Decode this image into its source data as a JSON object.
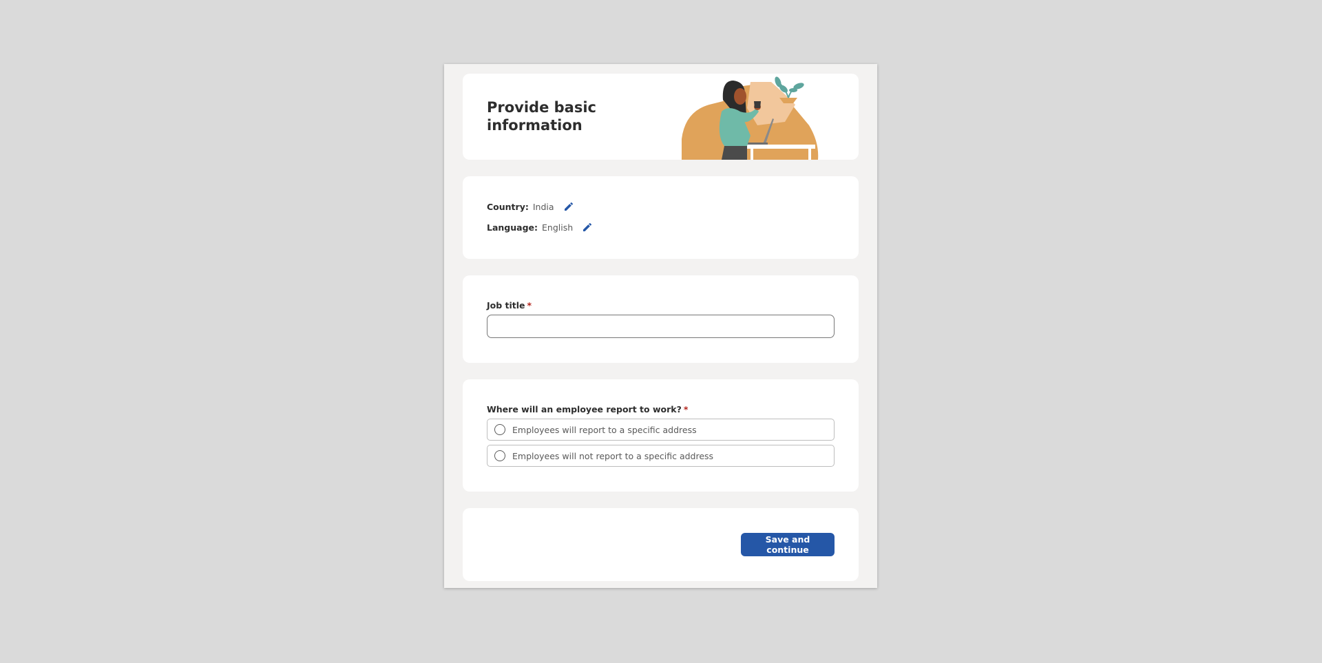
{
  "header": {
    "title": "Provide basic information",
    "illustration_icon": "woman-with-laptop-illustration"
  },
  "locale": {
    "country_label": "Country:",
    "country_value": "India",
    "language_label": "Language:",
    "language_value": "English",
    "edit_icon": "pencil-icon"
  },
  "job_title": {
    "label": "Job title",
    "required_marker": "*",
    "value": "",
    "placeholder": ""
  },
  "report_location": {
    "question": "Where will an employee report to work?",
    "required_marker": "*",
    "options": [
      {
        "label": "Employees will report to a specific address",
        "selected": false
      },
      {
        "label": "Employees will not report to a specific address",
        "selected": false
      }
    ]
  },
  "footer": {
    "save_label": "Save and continue"
  },
  "colors": {
    "accent": "#2557a7",
    "required": "#b3261e",
    "page_background": "#dadada",
    "modal_background": "#f3f2f1"
  }
}
